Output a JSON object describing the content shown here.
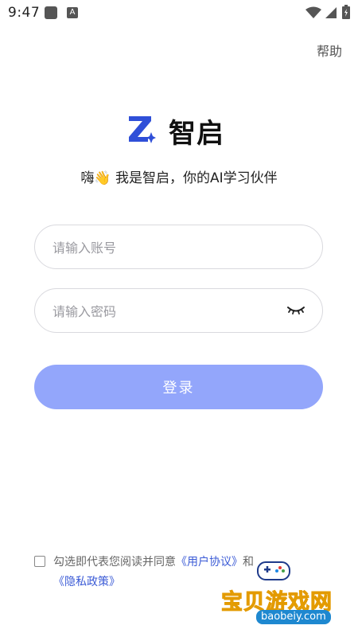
{
  "status_bar": {
    "time": "9:47",
    "a_icon": "A"
  },
  "header": {
    "help_label": "帮助"
  },
  "brand": {
    "name": "智启",
    "accent": "#2f4fd8"
  },
  "greeting": "嗨👋 我是智启，你的AI学习伙伴",
  "form": {
    "account_placeholder": "请输入账号",
    "password_placeholder": "请输入密码",
    "login_label": "登录"
  },
  "agreement": {
    "prefix": "勾选即代表您阅读并同意",
    "user_agreement": "《用户协议》",
    "and": "和",
    "privacy_policy": "《隐私政策》"
  },
  "watermark": {
    "text": "宝贝游戏网",
    "url": "baobeiy.com"
  },
  "icons": [
    "wifi-icon",
    "signal-icon",
    "battery-icon",
    "eye-closed-icon",
    "gamepad-icon"
  ],
  "colors": {
    "button": "#93a6fb",
    "link": "#3b5bd6",
    "border": "#d9d9de"
  }
}
